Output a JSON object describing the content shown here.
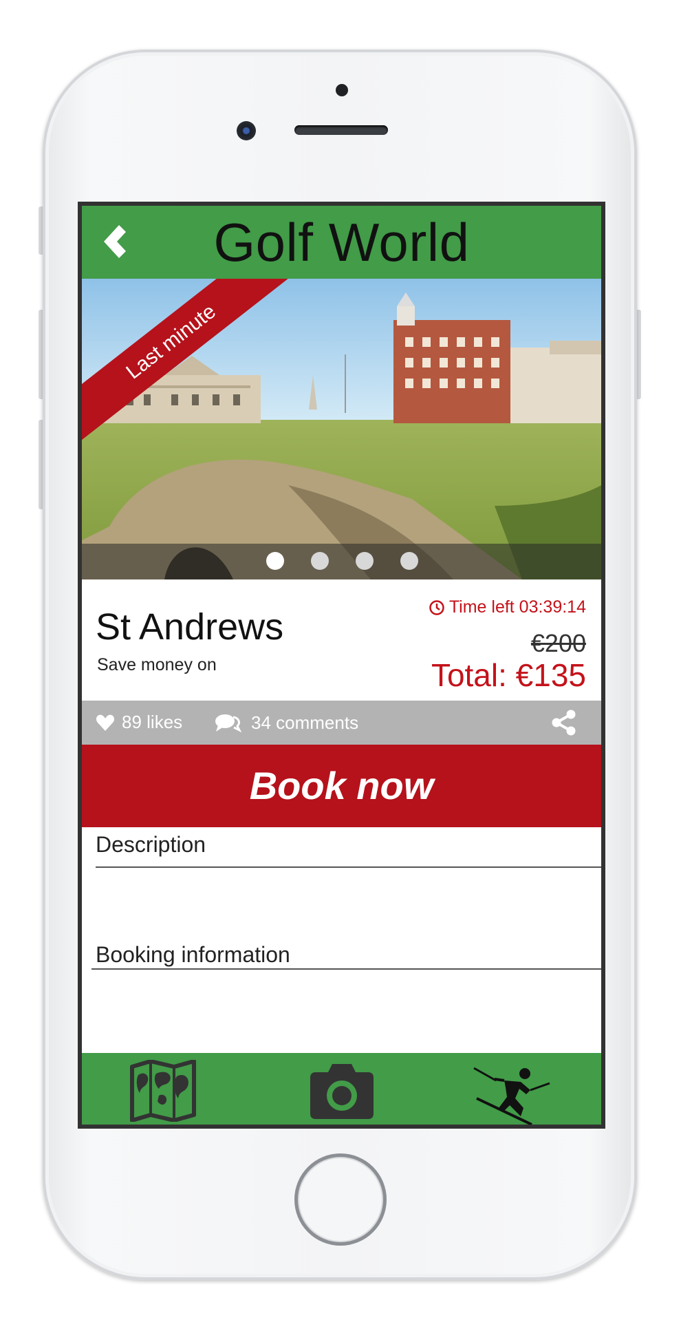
{
  "app": {
    "title": "Golf World"
  },
  "hero": {
    "ribbon": "Last minute",
    "slides": 4,
    "active_slide": 1
  },
  "offer": {
    "place": "St Andrews",
    "subtitle": "Save money on",
    "time_left": "Time left 03:39:14",
    "old_price": "€200",
    "total": "Total: €135"
  },
  "social": {
    "likes": "89 likes",
    "comments": "34 comments"
  },
  "actions": {
    "book": "Book now"
  },
  "sections": {
    "description": "Description",
    "booking_info": "Booking information"
  },
  "colors": {
    "brand_green": "#429c48",
    "accent_red": "#b5121b",
    "social_bar": "#b3b3b3"
  },
  "icons": {
    "back": "chevron-left-icon",
    "clock": "clock-icon",
    "heart": "heart-icon",
    "comments": "speech-bubbles-icon",
    "share": "share-icon",
    "tabs": [
      "map-icon",
      "camera-icon",
      "skier-icon"
    ]
  }
}
